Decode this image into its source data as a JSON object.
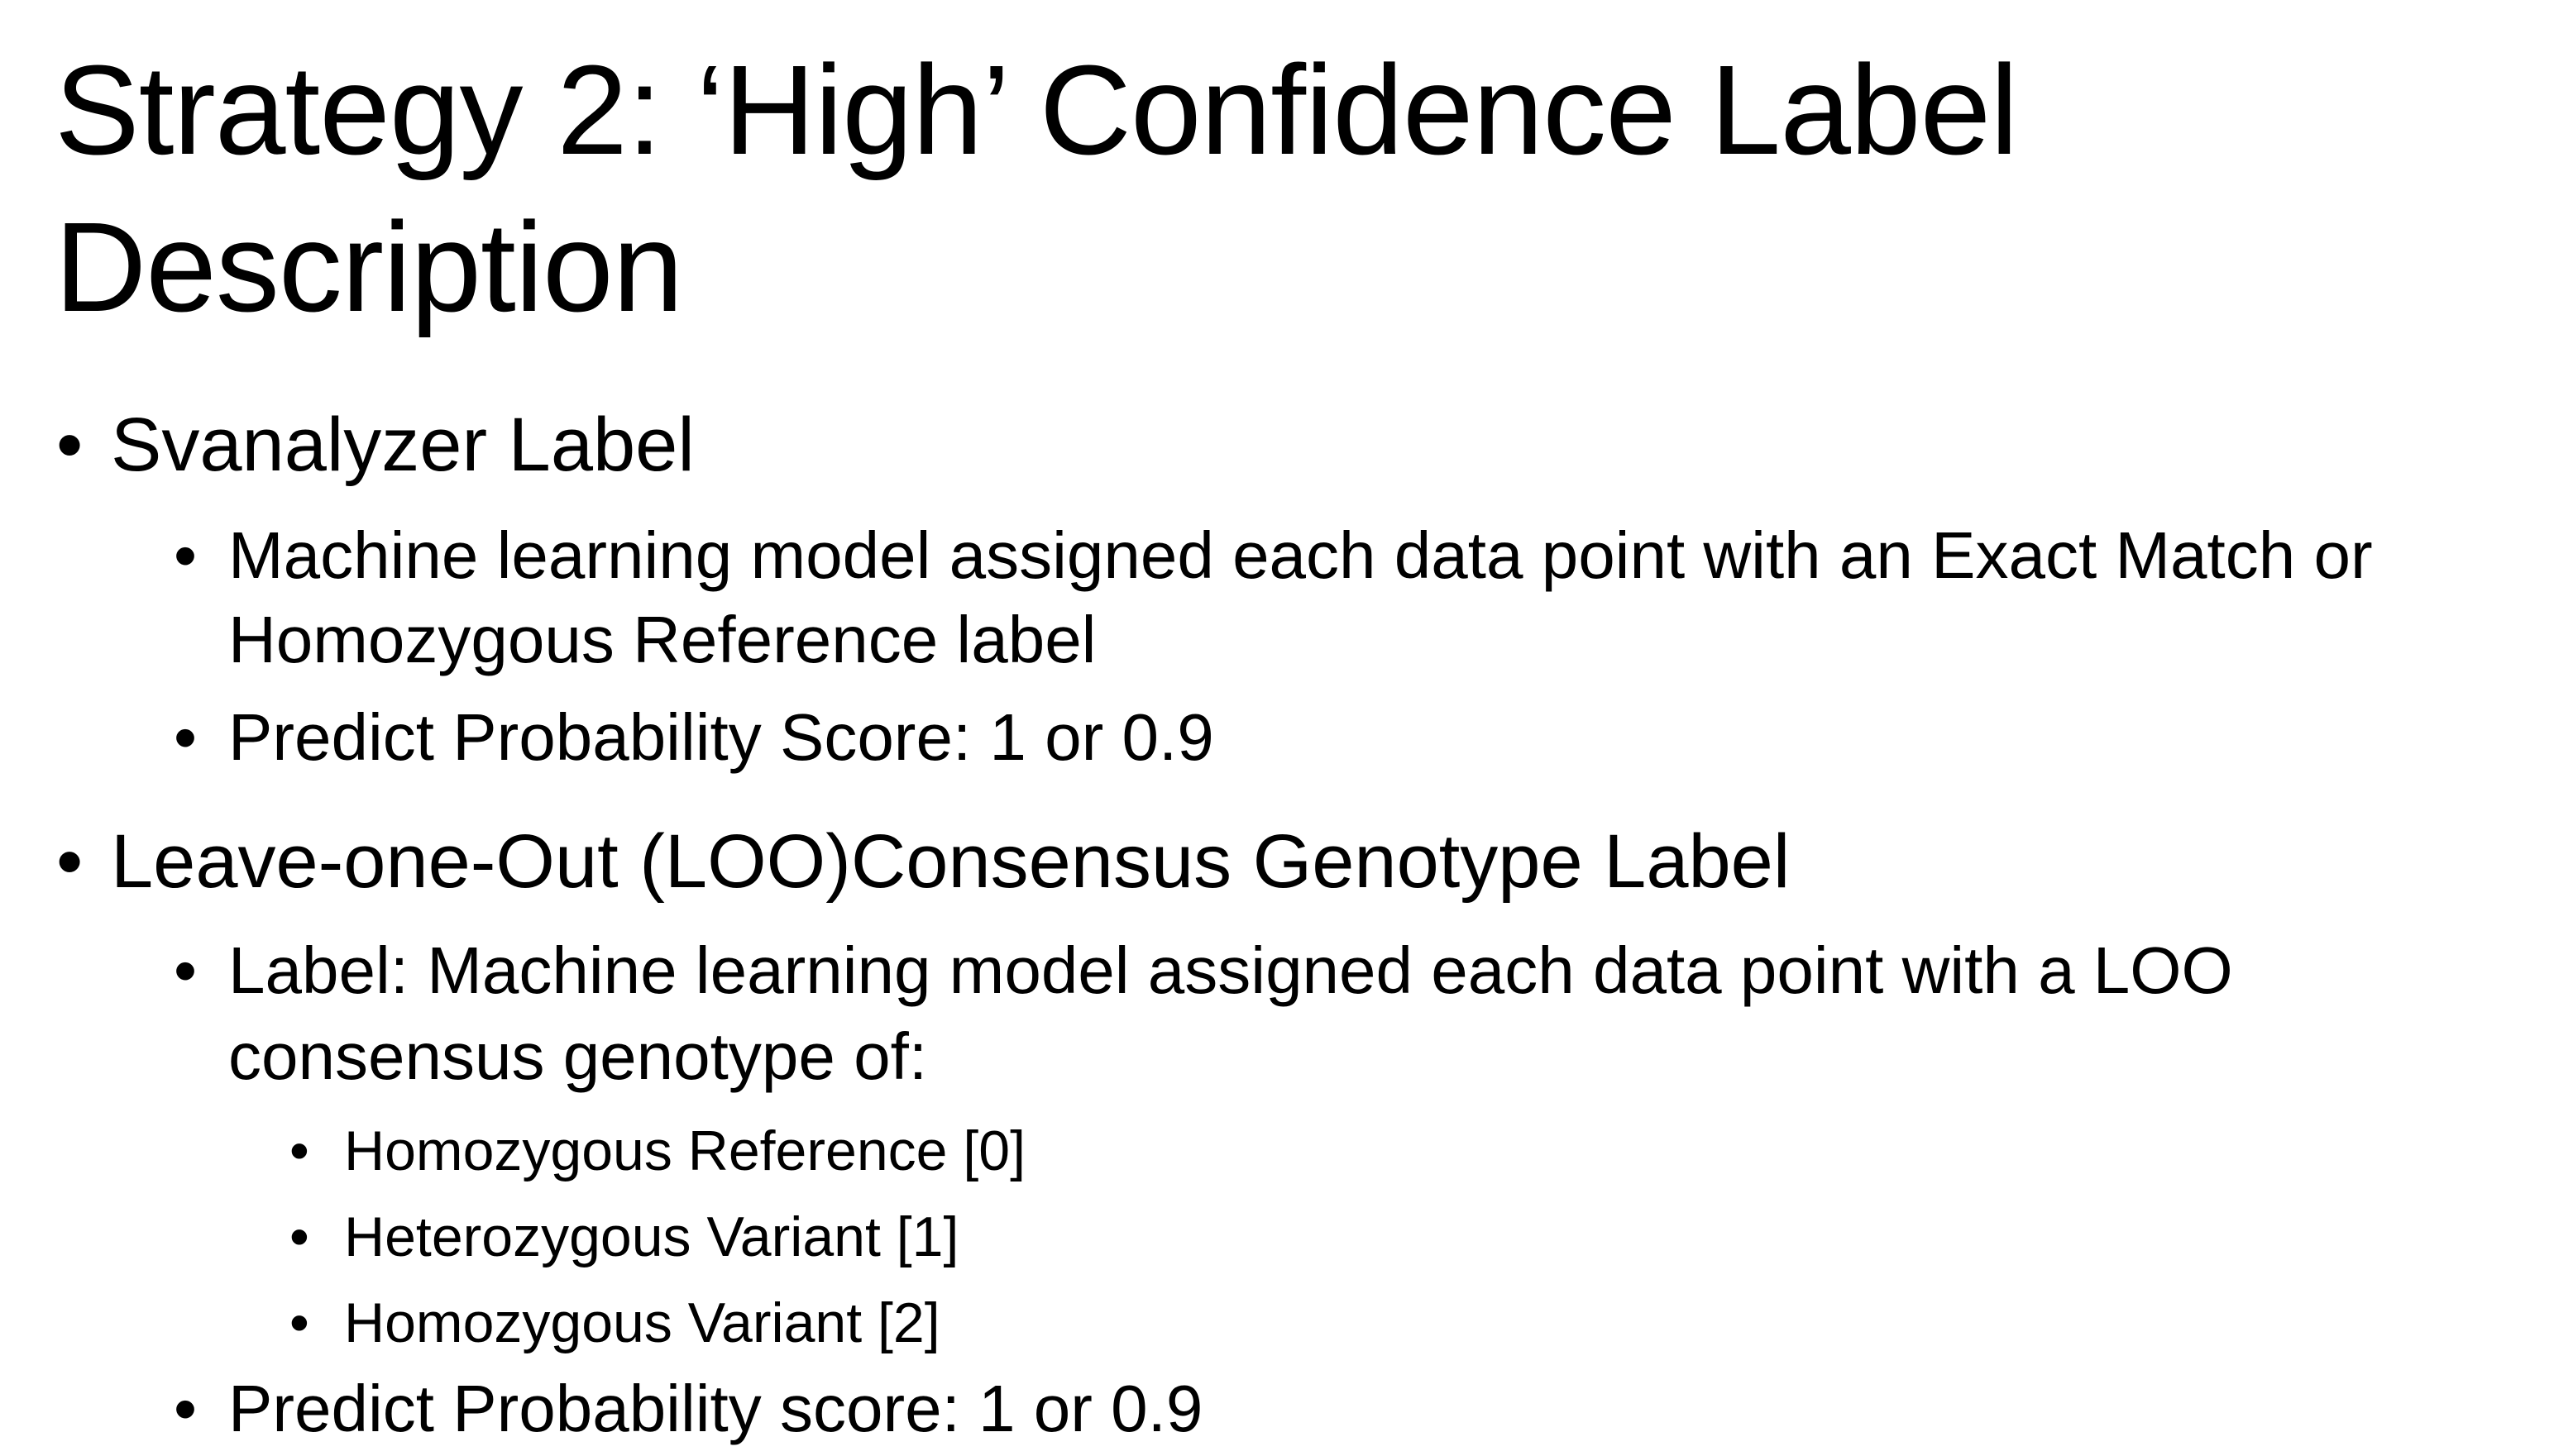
{
  "title": {
    "line1": "Strategy 2: ‘High’ Confidence Label",
    "line2": "Description"
  },
  "bullet_char": "•",
  "sections": [
    {
      "heading": "Svanalyzer Label",
      "items": [
        {
          "line1": "Machine learning model assigned each data point with an Exact Match or",
          "line2": "Homozygous Reference label"
        },
        {
          "line1": "Predict Probability Score: 1 or 0.9"
        }
      ]
    },
    {
      "heading": "Leave-one-Out (LOO)Consensus Genotype Label",
      "items": [
        {
          "line1": "Label: Machine learning model assigned each data point with a LOO",
          "line2": "consensus genotype of:",
          "subitems": [
            "Homozygous Reference [0]",
            "Heterozygous Variant [1]",
            "Homozygous Variant [2]"
          ]
        },
        {
          "line1": "Predict Probability score: 1 or 0.9"
        }
      ]
    }
  ]
}
